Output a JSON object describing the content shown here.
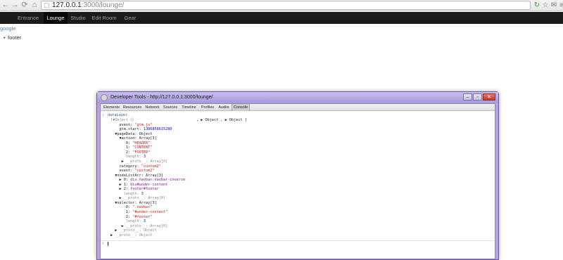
{
  "browser": {
    "url_host": "127.0.0.1",
    "url_rest": ":3000/lounge/"
  },
  "navbar": {
    "items": [
      {
        "label": "Entrance"
      },
      {
        "label": "Lounge"
      },
      {
        "label": "Studio"
      },
      {
        "label": "Edit Room"
      },
      {
        "label": "Gear"
      }
    ],
    "active": "Lounge"
  },
  "page": {
    "google_link": "google",
    "list_item": "footer"
  },
  "devtools": {
    "title": "Developer Tools - http://127.0.0.1:3000/lounge/",
    "tabs": [
      "Elements",
      "Resources",
      "Network",
      "Sources",
      "Timeline",
      "Profiles",
      "Audits",
      "Console"
    ],
    "active_tab": "Console",
    "console": {
      "command": "dataLayer",
      "output_lines": [
        {
          "parts": [
            [
              "g",
              "[▼Object "
            ],
            [
              "b",
              "ⓘ"
            ],
            [
              "",
              ""
            ]
          ]
        },
        {
          "parts": [
            [
              "",
              "    event: "
            ],
            [
              "s",
              "\"gtm.js\""
            ]
          ]
        },
        {
          "parts": [
            [
              "",
              "    gtm.start: "
            ],
            [
              "n",
              "1386858615280"
            ]
          ]
        },
        {
          "parts": [
            [
              "",
              "  ▼pageData: Object"
            ]
          ]
        },
        {
          "parts": [
            [
              "",
              "    ▼action: Array[3]"
            ]
          ]
        },
        {
          "parts": [
            [
              "",
              "       0: "
            ],
            [
              "s",
              "\"HEADER\""
            ]
          ]
        },
        {
          "parts": [
            [
              "",
              "       1: "
            ],
            [
              "s",
              "\"CONTENT\""
            ]
          ]
        },
        {
          "parts": [
            [
              "",
              "       2: "
            ],
            [
              "s",
              "\"FOOTER\""
            ]
          ]
        },
        {
          "parts": [
            [
              "g",
              "       length: "
            ],
            [
              "n",
              "3"
            ]
          ]
        },
        {
          "parts": [
            [
              "",
              "     ▶ "
            ],
            [
              "g",
              "__proto__: Array[0]"
            ]
          ]
        },
        {
          "parts": [
            [
              "",
              "    category: "
            ],
            [
              "s",
              "\"custom2\""
            ]
          ]
        },
        {
          "parts": [
            [
              "",
              "    event: "
            ],
            [
              "s",
              "\"custom2\""
            ]
          ]
        },
        {
          "parts": [
            [
              "",
              "  ▼nodeListArr: Array[3]"
            ]
          ]
        },
        {
          "parts": [
            [
              "",
              "    ▶ 0: "
            ],
            [
              "k",
              "div.navbar.navbar-inverse"
            ]
          ]
        },
        {
          "parts": [
            [
              "",
              "    ▶ 1: "
            ],
            [
              "k",
              "div#under-content"
            ]
          ]
        },
        {
          "parts": [
            [
              "",
              "    ▶ 2: "
            ],
            [
              "k",
              "footer#footer"
            ]
          ]
        },
        {
          "parts": [
            [
              "g",
              "      length: "
            ],
            [
              "n",
              "3"
            ]
          ]
        },
        {
          "parts": [
            [
              "",
              "    ▶ "
            ],
            [
              "g",
              "__proto__: Array[0]"
            ]
          ]
        },
        {
          "parts": [
            [
              "",
              "  ▼selector: Array[3]"
            ]
          ]
        },
        {
          "parts": [
            [
              "",
              "       0: "
            ],
            [
              "s",
              "\".navbar\""
            ]
          ]
        },
        {
          "parts": [
            [
              "",
              "       1: "
            ],
            [
              "s",
              "\"#under-content\""
            ]
          ]
        },
        {
          "parts": [
            [
              "",
              "       2: "
            ],
            [
              "s",
              "\"#footer\""
            ]
          ]
        },
        {
          "parts": [
            [
              "g",
              "       length: "
            ],
            [
              "n",
              "3"
            ]
          ]
        },
        {
          "parts": [
            [
              "",
              "     ▶ "
            ],
            [
              "g",
              "__proto__: Array[0]"
            ]
          ]
        },
        {
          "parts": [
            [
              "",
              "  ▶ "
            ],
            [
              "g",
              "__proto__: Object"
            ]
          ]
        },
        {
          "parts": [
            [
              "",
              "▶ "
            ],
            [
              "g",
              "__proto__: Object"
            ]
          ]
        }
      ],
      "tail": ", ▶ Object , ▶ Object ]"
    }
  }
}
